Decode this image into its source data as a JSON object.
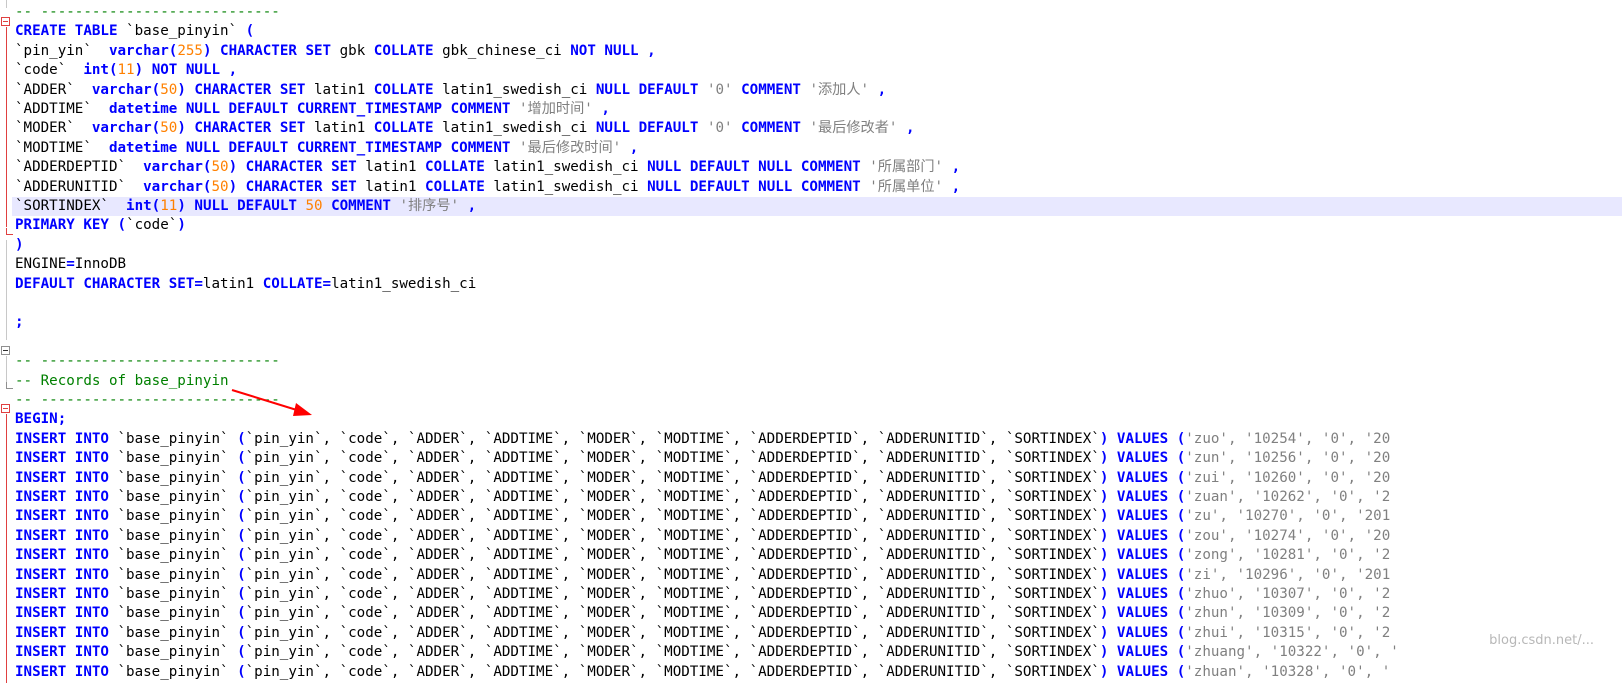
{
  "editor": {
    "lines": [
      {
        "text": "-- ----------------------------",
        "cls": "cm"
      },
      {
        "html": "<span class='kw'>CREATE TABLE</span> `base_pinyin` <span class='kw'>(</span>"
      },
      {
        "html": "`pin_yin`  <span class='kw'>varchar</span><span class='kw'>(</span><span class='num'>255</span><span class='kw'>)</span> <span class='kw'>CHARACTER SET</span> gbk <span class='kw'>COLLATE</span> gbk_chinese_ci <span class='kw'>NOT NULL</span> <span class='kw'>,</span>"
      },
      {
        "html": "`code`  <span class='kw'>int</span><span class='kw'>(</span><span class='num'>11</span><span class='kw'>)</span> <span class='kw'>NOT NULL</span> <span class='kw'>,</span>"
      },
      {
        "html": "`ADDER`  <span class='kw'>varchar</span><span class='kw'>(</span><span class='num'>50</span><span class='kw'>)</span> <span class='kw'>CHARACTER SET</span> latin1 <span class='kw'>COLLATE</span> latin1_swedish_ci <span class='kw'>NULL DEFAULT</span> <span class='str'>'0'</span> <span class='kw'>COMMENT</span> <span class='str'>'添加人'</span> <span class='kw'>,</span>"
      },
      {
        "html": "`ADDTIME`  <span class='kw'>datetime NULL DEFAULT CURRENT_TIMESTAMP COMMENT</span> <span class='str'>'增加时间'</span> <span class='kw'>,</span>"
      },
      {
        "html": "`MODER`  <span class='kw'>varchar</span><span class='kw'>(</span><span class='num'>50</span><span class='kw'>)</span> <span class='kw'>CHARACTER SET</span> latin1 <span class='kw'>COLLATE</span> latin1_swedish_ci <span class='kw'>NULL DEFAULT</span> <span class='str'>'0'</span> <span class='kw'>COMMENT</span> <span class='str'>'最后修改者'</span> <span class='kw'>,</span>"
      },
      {
        "html": "`MODTIME`  <span class='kw'>datetime NULL DEFAULT CURRENT_TIMESTAMP COMMENT</span> <span class='str'>'最后修改时间'</span> <span class='kw'>,</span>"
      },
      {
        "html": "`ADDERDEPTID`  <span class='kw'>varchar</span><span class='kw'>(</span><span class='num'>50</span><span class='kw'>)</span> <span class='kw'>CHARACTER SET</span> latin1 <span class='kw'>COLLATE</span> latin1_swedish_ci <span class='kw'>NULL DEFAULT NULL COMMENT</span> <span class='str'>'所属部门'</span> <span class='kw'>,</span>"
      },
      {
        "html": "`ADDERUNITID`  <span class='kw'>varchar</span><span class='kw'>(</span><span class='num'>50</span><span class='kw'>)</span> <span class='kw'>CHARACTER SET</span> latin1 <span class='kw'>COLLATE</span> latin1_swedish_ci <span class='kw'>NULL DEFAULT NULL COMMENT</span> <span class='str'>'所属单位'</span> <span class='kw'>,</span>"
      },
      {
        "html": "`SORTINDEX`  <span class='kw'>int</span><span class='kw'>(</span><span class='num'>11</span><span class='kw'>)</span> <span class='kw'>NULL DEFAULT</span> <span class='num'>50</span> <span class='kw'>COMMENT</span> <span class='str'>'排序号'</span> <span class='kw'>,</span>",
        "hl": true
      },
      {
        "html": "<span class='kw'>PRIMARY KEY</span> <span class='kw'>(</span>`code`<span class='kw'>)</span>"
      },
      {
        "html": "<span class='kw'>)</span>"
      },
      {
        "html": "ENGINE<span class='kw'>=</span>InnoDB"
      },
      {
        "html": "<span class='kw'>DEFAULT CHARACTER SET</span><span class='kw'>=</span>latin1 <span class='kw'>COLLATE</span><span class='kw'>=</span>latin1_swedish_ci"
      },
      {
        "text": ""
      },
      {
        "html": "<span class='kw'>;</span>"
      },
      {
        "text": ""
      },
      {
        "text": "-- ----------------------------",
        "cls": "cm"
      },
      {
        "text": "-- Records of base_pinyin",
        "cls": "cm"
      },
      {
        "text": "-- ----------------------------",
        "cls": "cm"
      },
      {
        "html": "<span class='kw'>BEGIN;</span>"
      }
    ],
    "insert_prefix": "INSERT INTO",
    "insert_table": " `base_pinyin` ",
    "insert_columns": "`pin_yin`, `code`, `ADDER`, `ADDTIME`, `MODER`, `MODTIME`, `ADDERDEPTID`, `ADDERUNITID`, `SORTINDEX`",
    "insert_values_kw": "VALUES",
    "insert_rows": [
      {
        "tail": "'zuo', '10254', '0', '20"
      },
      {
        "tail": "'zun', '10256', '0', '20"
      },
      {
        "tail": "'zui', '10260', '0', '20"
      },
      {
        "tail": "'zuan', '10262', '0', '2"
      },
      {
        "tail": "'zu', '10270', '0', '201"
      },
      {
        "tail": "'zou', '10274', '0', '20"
      },
      {
        "tail": "'zong', '10281', '0', '2"
      },
      {
        "tail": "'zi', '10296', '0', '201"
      },
      {
        "tail": "'zhuo', '10307', '0', '2"
      },
      {
        "tail": "'zhun', '10309', '0', '2"
      },
      {
        "tail": "'zhui', '10315', '0', '2"
      },
      {
        "tail": "'zhuang', '10322', '0', '"
      },
      {
        "tail": "'zhuan', '10328', '0', '"
      }
    ],
    "watermark": "blog.csdn.net/..."
  }
}
